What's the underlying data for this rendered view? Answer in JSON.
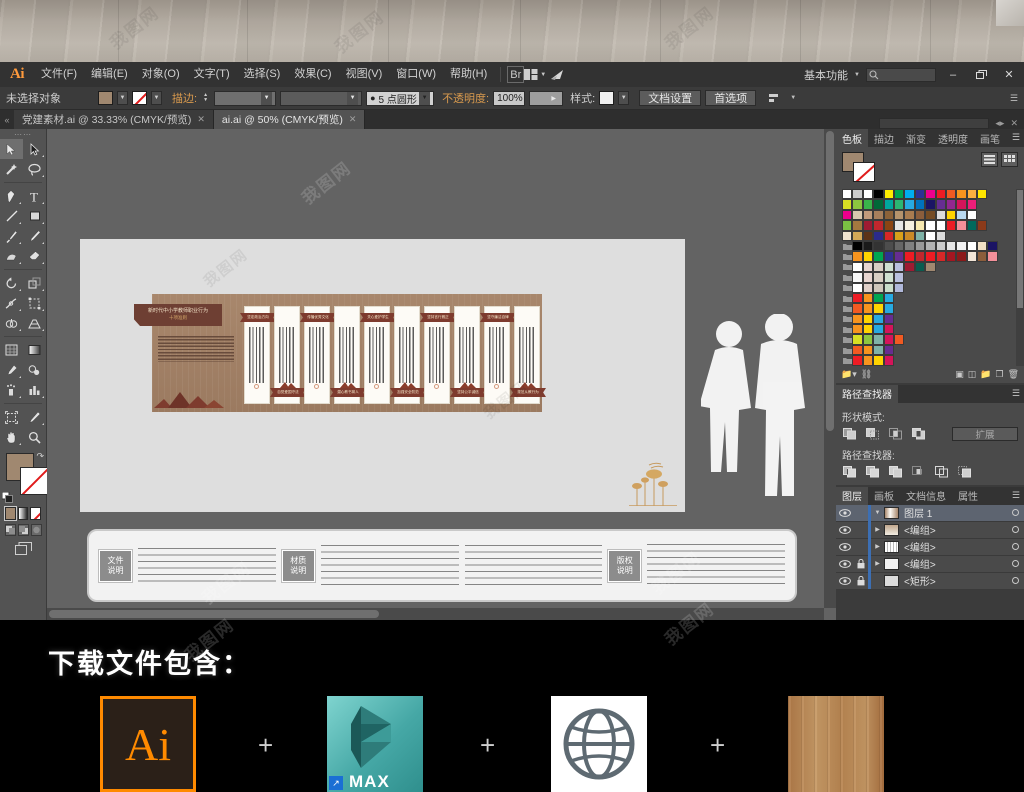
{
  "app": {
    "name_icon": "Ai",
    "workspace": "基本功能",
    "search_placeholder": ""
  },
  "menubar": {
    "items": [
      {
        "label": "文件(F)"
      },
      {
        "label": "编辑(E)"
      },
      {
        "label": "对象(O)"
      },
      {
        "label": "文字(T)"
      },
      {
        "label": "选择(S)"
      },
      {
        "label": "效果(C)"
      },
      {
        "label": "视图(V)"
      },
      {
        "label": "窗口(W)"
      },
      {
        "label": "帮助(H)"
      }
    ],
    "bridge_icon": "br-icon",
    "arrange_icon": "arrange-documents-icon",
    "stock_icon": "stock-icon",
    "window_buttons": {
      "minimize": "–",
      "restore": "❐",
      "close": "✕"
    }
  },
  "controlbar": {
    "selection_status": "未选择对象",
    "fill_color": "#a08870",
    "stroke_color": "none",
    "stroke_label": "描边:",
    "stroke_weight": "",
    "stroke_profile": "",
    "brush_definition": "5 点圆形",
    "opacity_label": "不透明度:",
    "opacity_value": "100%",
    "style_label": "样式:",
    "doc_setup_button": "文档设置",
    "preferences_button": "首选项",
    "align_icon": "align-icon",
    "panel_menu_icon": "panel-menu-icon"
  },
  "tabs": [
    {
      "label": "党建素材.ai @ 33.33% (CMYK/预览)",
      "active": false,
      "close": "✕"
    },
    {
      "label": "ai.ai @ 50% (CMYK/预览)",
      "active": true,
      "close": "✕"
    }
  ],
  "toolbox": {
    "tools": [
      {
        "name": "selection-tool",
        "selected": true
      },
      {
        "name": "direct-selection-tool",
        "selected": false
      },
      {
        "name": "magic-wand-tool",
        "selected": false
      },
      {
        "name": "lasso-tool",
        "selected": false
      },
      {
        "name": "pen-tool",
        "selected": false
      },
      {
        "name": "type-tool",
        "selected": false
      },
      {
        "name": "line-segment-tool",
        "selected": false
      },
      {
        "name": "rectangle-tool",
        "selected": false
      },
      {
        "name": "paintbrush-tool",
        "selected": false
      },
      {
        "name": "pencil-tool",
        "selected": false
      },
      {
        "name": "shaper-tool",
        "selected": false
      },
      {
        "name": "eraser-tool",
        "selected": false
      },
      {
        "name": "rotate-tool",
        "selected": false
      },
      {
        "name": "scale-tool",
        "selected": false
      },
      {
        "name": "width-tool",
        "selected": false
      },
      {
        "name": "free-transform-tool",
        "selected": false
      },
      {
        "name": "shape-builder-tool",
        "selected": false
      },
      {
        "name": "perspective-grid-tool",
        "selected": false
      },
      {
        "name": "mesh-tool",
        "selected": false
      },
      {
        "name": "gradient-tool",
        "selected": false
      },
      {
        "name": "eyedropper-tool",
        "selected": false
      },
      {
        "name": "blend-tool",
        "selected": false
      },
      {
        "name": "symbol-sprayer-tool",
        "selected": false
      },
      {
        "name": "column-graph-tool",
        "selected": false
      },
      {
        "name": "artboard-tool",
        "selected": false
      },
      {
        "name": "slice-tool",
        "selected": false
      },
      {
        "name": "hand-tool",
        "selected": false
      },
      {
        "name": "zoom-tool",
        "selected": false
      }
    ],
    "fill_color": "#a08870",
    "stroke_color": "none",
    "color_modes": [
      "color",
      "gradient",
      "none"
    ],
    "draw_modes": [
      "draw-normal",
      "draw-behind",
      "draw-inside"
    ],
    "screen_mode": "change-screen-mode"
  },
  "artwork": {
    "title_main": "新时代中小学教师职业行为",
    "title_sub": "十项准则",
    "panels": [
      {
        "top_tag": "坚定政治方向",
        "bottom_tag": ""
      },
      {
        "top_tag": "",
        "bottom_tag": "自觉爱国守法"
      },
      {
        "top_tag": "传播优秀文化",
        "bottom_tag": ""
      },
      {
        "top_tag": "",
        "bottom_tag": "潜心教书育人"
      },
      {
        "top_tag": "关心爱护学生",
        "bottom_tag": ""
      },
      {
        "top_tag": "",
        "bottom_tag": "加强安全防范"
      },
      {
        "top_tag": "坚持言行雅正",
        "bottom_tag": ""
      },
      {
        "top_tag": "",
        "bottom_tag": "坚持公平诚信"
      },
      {
        "top_tag": "坚守廉洁自律",
        "bottom_tag": ""
      },
      {
        "top_tag": "",
        "bottom_tag": "规范从教行为"
      }
    ],
    "wall_color": "#a8876c",
    "tag_color": "#7e3b2e",
    "notes": [
      {
        "badge_line1": "文件",
        "badge_line2": "说明"
      },
      {
        "badge_line1": "材质",
        "badge_line2": "说明"
      },
      {
        "badge_line1": "版权",
        "badge_line2": "说明"
      }
    ]
  },
  "dock": {
    "top_panel": {
      "tabs": [
        "色板",
        "描边",
        "渐变",
        "透明度",
        "画笔"
      ],
      "active_tab": "色板",
      "view_list_icon": "list-view-icon",
      "view_grid_icon": "grid-view-icon",
      "footer_icons": [
        "swatch-libraries-icon",
        "swatch-link-icon",
        "show-swatch-kinds-icon",
        "swatch-options-icon",
        "new-color-group-icon",
        "new-swatch-icon",
        "delete-swatch-icon"
      ],
      "swatch_rows": [
        [
          "#ffffff",
          "#cccccc",
          "#ffffff",
          "#000000",
          "#ffed00",
          "#00a651",
          "#00aeef",
          "#2e3192",
          "#ec008c",
          "#ed1c24",
          "#f15a22",
          "#f7941e",
          "#fbb040",
          "#ffe600"
        ],
        [
          "#d7df23",
          "#8dc63f",
          "#39b54a",
          "#006838",
          "#00a79d",
          "#2bb673",
          "#27aae1",
          "#0072bc",
          "#1b1464",
          "#662d91",
          "#92278f",
          "#d4145a",
          "#ed1e79"
        ],
        [
          "#ec008c",
          "#d9c8ae",
          "#c19a7b",
          "#a87f5c",
          "#8c6239",
          "#b5936c",
          "#a97c50",
          "#8b5e3c",
          "#754c24",
          "#dcdcdc",
          "#ffd400",
          "#b9d9f0",
          "#ffffff"
        ],
        [
          "#7ac143",
          "#a3783f",
          "#9e1b32",
          "#c1272d",
          "#8b4513",
          "#e6e6e6",
          "#f5f0e1",
          "#f7e9b0",
          "#ffffff",
          "#ffffff",
          "#ed1c24",
          "#f4909a",
          "#00695c",
          "#8b3a1a"
        ],
        [
          "#efe3cf",
          "#d3a857",
          "#5c3317",
          "#2b2b8c",
          "#d62828",
          "#d8a01a",
          "#c98a27",
          "#7fb3a8",
          "#ffffff",
          "#dcdcdc"
        ]
      ],
      "gray_rows": [
        [
          "#000000",
          "#1a1a1a",
          "#333333",
          "#4d4d4d",
          "#666666",
          "#808080",
          "#999999",
          "#b3b3b3",
          "#cccccc",
          "#e6e6e6",
          "#f2f2f2",
          "#ffffff",
          "#f1e0c6",
          "#1b1464"
        ],
        [
          "#f7941e",
          "#ffd400",
          "#00a651",
          "#2e3192",
          "#662d91",
          "#ed1c24",
          "#c1272d",
          "#ed1c24",
          "#d62828",
          "#a31621",
          "#8b1a1a",
          "#f2e6d8",
          "#8b5e3c",
          "#f4909a"
        ],
        [
          "#ffffff",
          "#e8d5d0",
          "#d9cfc4",
          "#cfe0d0",
          "#b9c0de",
          "#9e1b32",
          "#0a5c4f",
          "#a08870"
        ],
        [
          "#f7f7f7",
          "#e8d5d0",
          "#d9cfc4",
          "#cfe0d0",
          "#b9c0de"
        ],
        [
          "#ffffff",
          "#e0cfc8",
          "#cfc6ba",
          "#c9ddca",
          "#b0b8da"
        ],
        [
          "#ed1c24",
          "#f7941e",
          "#00a651",
          "#27aae1"
        ],
        [
          "#f15a22",
          "#f7941e",
          "#ffd400",
          "#27aae1"
        ],
        [
          "#f7941e",
          "#ffd400",
          "#27aae1",
          "#662d91"
        ],
        [
          "#f7941e",
          "#ffd400",
          "#27aae1",
          "#d4145a"
        ],
        [
          "#d7df23",
          "#8dc63f",
          "#7fb3a8",
          "#d4145a",
          "#f15a22"
        ],
        [
          "#f15a22",
          "#f7941e",
          "#7fb3a8",
          "#662d91"
        ],
        [
          "#ed1c24",
          "#f7941e",
          "#ffd400",
          "#d4145a"
        ]
      ]
    },
    "pathfinder": {
      "tab": "路径查找器",
      "shape_modes_label": "形状模式:",
      "shape_modes": [
        "unite-icon",
        "minus-front-icon",
        "intersect-icon",
        "exclude-icon"
      ],
      "expand_button": "扩展",
      "pathfinders_label": "路径查找器:",
      "pathfinders": [
        "divide-icon",
        "trim-icon",
        "merge-icon",
        "crop-icon",
        "outline-icon",
        "minus-back-icon"
      ]
    },
    "layers": {
      "tabs": [
        "图层",
        "画板",
        "文档信息",
        "属性"
      ],
      "active_tab": "图层",
      "rows": [
        {
          "name": "图层 1",
          "selected": true,
          "locked": false,
          "expandable": true,
          "expanded": true
        },
        {
          "name": "<编组>",
          "selected": false,
          "locked": false,
          "expandable": true,
          "expanded": false
        },
        {
          "name": "<编组>",
          "selected": false,
          "locked": false,
          "expandable": true,
          "expanded": false
        },
        {
          "name": "<编组>",
          "selected": false,
          "locked": true,
          "expandable": true,
          "expanded": false
        },
        {
          "name": "<矩形>",
          "selected": false,
          "locked": true,
          "expandable": false,
          "expanded": false
        }
      ]
    }
  },
  "banner": {
    "title": "下载文件包含：",
    "items": [
      {
        "name": "ai-file-icon",
        "label": "Ai"
      },
      {
        "name": "max-file-icon",
        "label": "MAX"
      },
      {
        "name": "globe-file-icon",
        "label": ""
      },
      {
        "name": "wood-texture-icon",
        "label": ""
      }
    ],
    "separator": "+"
  },
  "watermark": {
    "text": "我图网"
  }
}
